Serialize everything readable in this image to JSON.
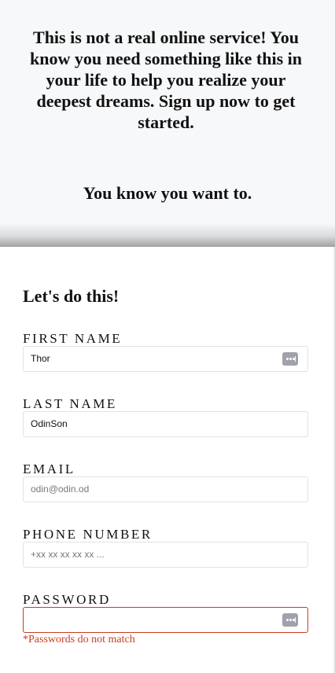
{
  "hero": {
    "message": "This is not a real online service! You know you need something like this in your life to help you realize your deepest dreams. Sign up now to get started.",
    "tagline": "You know you want to."
  },
  "form": {
    "title": "Let's do this!",
    "fields": {
      "first_name": {
        "label": "FIRST NAME",
        "value": "Thor"
      },
      "last_name": {
        "label": "LAST NAME",
        "value": "OdinSon"
      },
      "email": {
        "label": "EMAIL",
        "placeholder": "odin@odin.od"
      },
      "phone": {
        "label": "PHONE NUMBER",
        "placeholder": "+xx xx xx xx xx ..."
      },
      "password": {
        "label": "PASSWORD",
        "value": ""
      }
    },
    "password_error": "*Passwords do not match"
  },
  "icons": {
    "autofill": "password-manager-key-icon"
  },
  "colors": {
    "hero_background": "#f7f8fa",
    "error": "#cc3b1f",
    "input_border": "#e3e3e3",
    "autofill_icon": "#9fa2ad"
  }
}
